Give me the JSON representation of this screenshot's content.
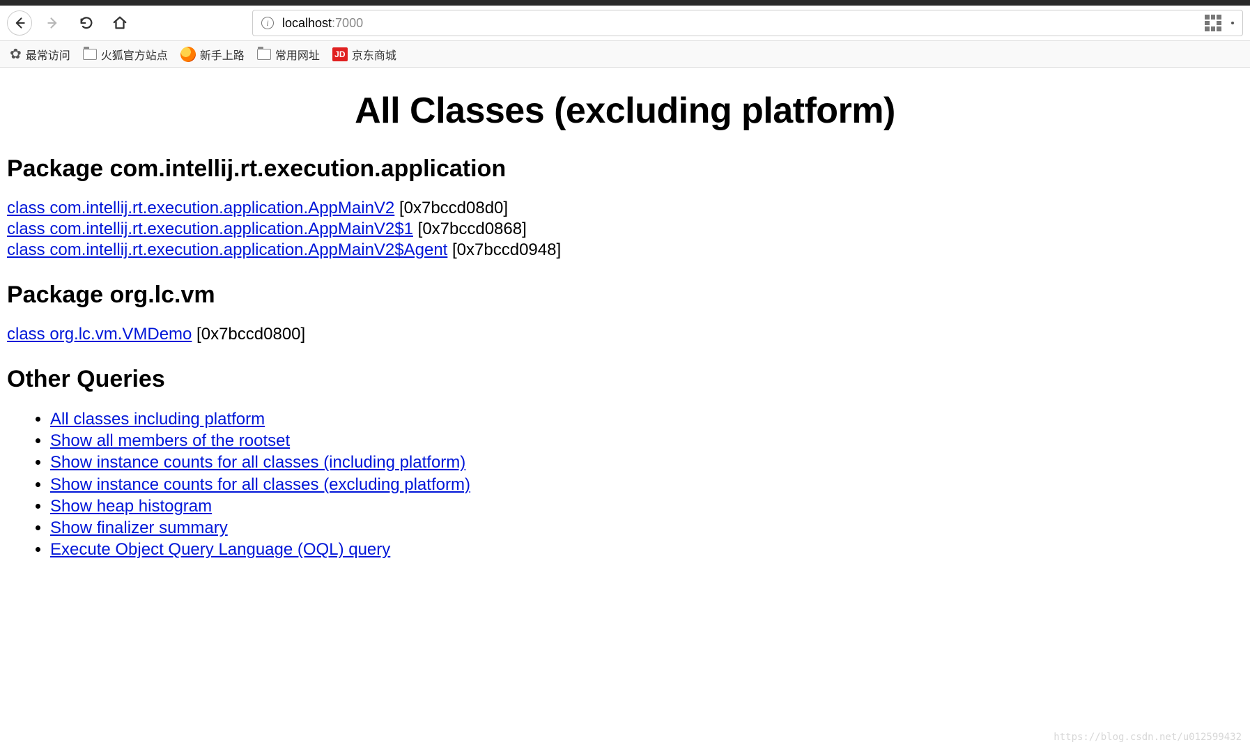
{
  "browser": {
    "url_host": "localhost",
    "url_port": ":7000"
  },
  "bookmarks": {
    "most_visited": "最常访问",
    "firefox_official": "火狐官方站点",
    "getting_started": "新手上路",
    "common_urls": "常用网址",
    "jd": "京东商城",
    "jd_icon": "JD"
  },
  "page": {
    "title": "All Classes (excluding platform)",
    "packages": [
      {
        "heading": "Package com.intellij.rt.execution.application",
        "classes": [
          {
            "link": "class com.intellij.rt.execution.application.AppMainV2",
            "addr": " [0x7bccd08d0]"
          },
          {
            "link": "class com.intellij.rt.execution.application.AppMainV2$1",
            "addr": " [0x7bccd0868]"
          },
          {
            "link": "class com.intellij.rt.execution.application.AppMainV2$Agent",
            "addr": " [0x7bccd0948]"
          }
        ]
      },
      {
        "heading": "Package org.lc.vm",
        "classes": [
          {
            "link": "class org.lc.vm.VMDemo",
            "addr": " [0x7bccd0800]"
          }
        ]
      }
    ],
    "other_heading": "Other Queries",
    "other_queries": [
      "All classes including platform",
      "Show all members of the rootset",
      "Show instance counts for all classes (including platform)",
      "Show instance counts for all classes (excluding platform)",
      "Show heap histogram",
      "Show finalizer summary",
      "Execute Object Query Language (OQL) query"
    ]
  },
  "watermark": "https://blog.csdn.net/u012599432"
}
